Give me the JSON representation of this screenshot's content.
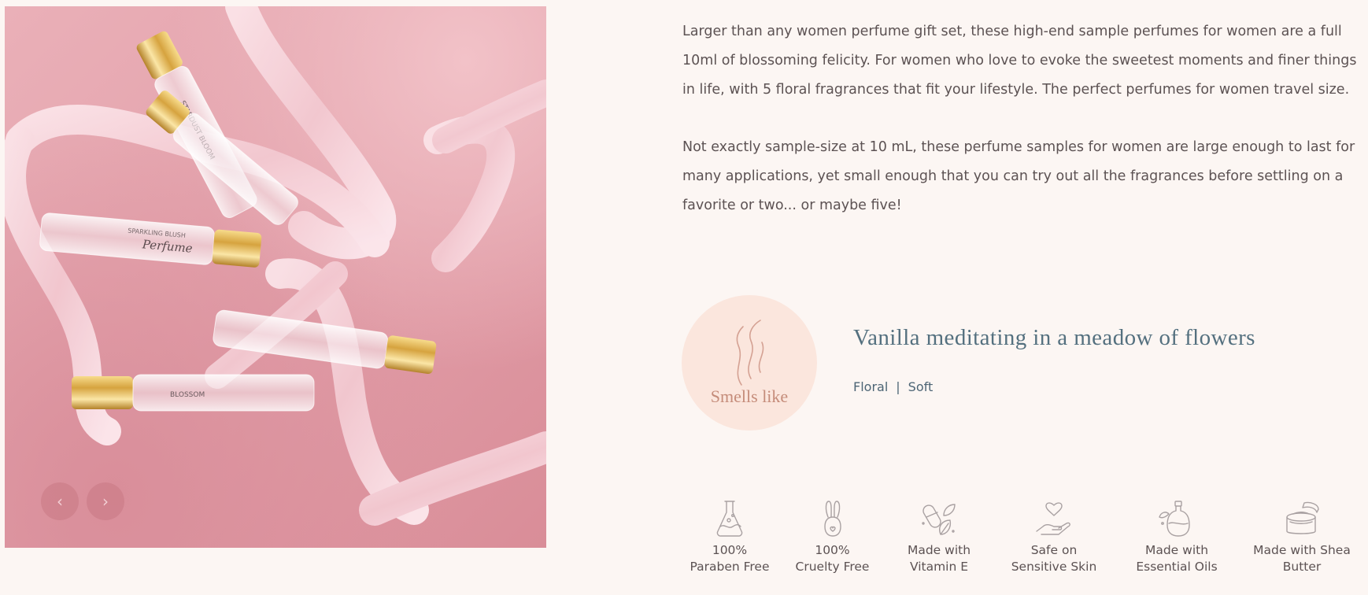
{
  "gallery": {
    "image_alt": "Five perfume rollerball bottles with gold caps and pink ribbons",
    "prev_label": "‹",
    "next_label": "›",
    "bottle_labels": {
      "top": "STARDUST BLOOM",
      "middle_brand": "SPARKLING BLUSH",
      "middle_script": "Perfume",
      "bottom": "BLOSSOM"
    }
  },
  "description": {
    "paragraph_1": "Larger than any women perfume gift set, these high-end sample perfumes for women are a full 10ml of blossoming felicity. For women who love to evoke the sweetest moments and finer things in life, with 5 floral fragrances that fit your lifestyle. The perfect perfumes for women travel size.",
    "paragraph_2": "Not exactly sample-size at 10 mL, these perfume samples for women are large enough to last for many applications, yet small enough that you can try out all the fragrances before settling on a favorite or two... or maybe five!"
  },
  "scent": {
    "badge_label": "Smells like",
    "badge_icon": "scent-wisp-icon",
    "title": "Vanilla meditating in a meadow of flowers",
    "note_1": "Floral",
    "separator": "|",
    "note_2": "Soft"
  },
  "benefits": [
    {
      "icon": "flask-icon",
      "label": "100%\nParaben Free"
    },
    {
      "icon": "bunny-icon",
      "label": "100%\nCruelty Free"
    },
    {
      "icon": "capsule-leaf-icon",
      "label": "Made with\nVitamin E"
    },
    {
      "icon": "hand-heart-icon",
      "label": "Safe on\nSensitive Skin"
    },
    {
      "icon": "oil-bottle-icon",
      "label": "Made with\nEssential Oils"
    },
    {
      "icon": "butter-jar-icon",
      "label": "Made with Shea\nButter"
    }
  ],
  "colors": {
    "background": "#fcf6f3",
    "photo_pink": "#e3a1ab",
    "badge_bg": "#fbe6dd",
    "badge_text": "#c58c7a",
    "title_blue": "#54707f",
    "icon_stroke": "#a9a1a2"
  }
}
